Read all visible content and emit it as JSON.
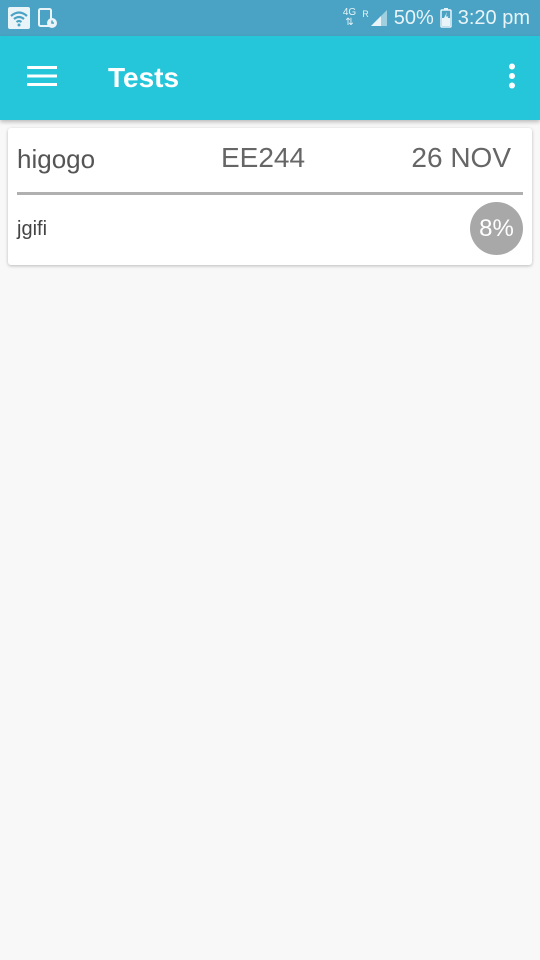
{
  "status_bar": {
    "left_icons": [
      "wifi-icon",
      "screen-timer-icon"
    ],
    "network": "4G",
    "roaming": "R",
    "battery_percent": "50%",
    "time": "3:20 pm",
    "colors": {
      "background": "#4aa3c4",
      "text": "#e8f4f8"
    }
  },
  "app_bar": {
    "title": "Tests",
    "menu_icon": "menu-icon",
    "overflow_icon": "more-vert-icon",
    "colors": {
      "background": "#26c6da",
      "title": "#ffffff"
    }
  },
  "tests": [
    {
      "name": "higogo",
      "code": "EE244",
      "date": "26 NOV",
      "description": "jgifi",
      "score": "8%",
      "badge_color": "#a8a8a8"
    }
  ]
}
